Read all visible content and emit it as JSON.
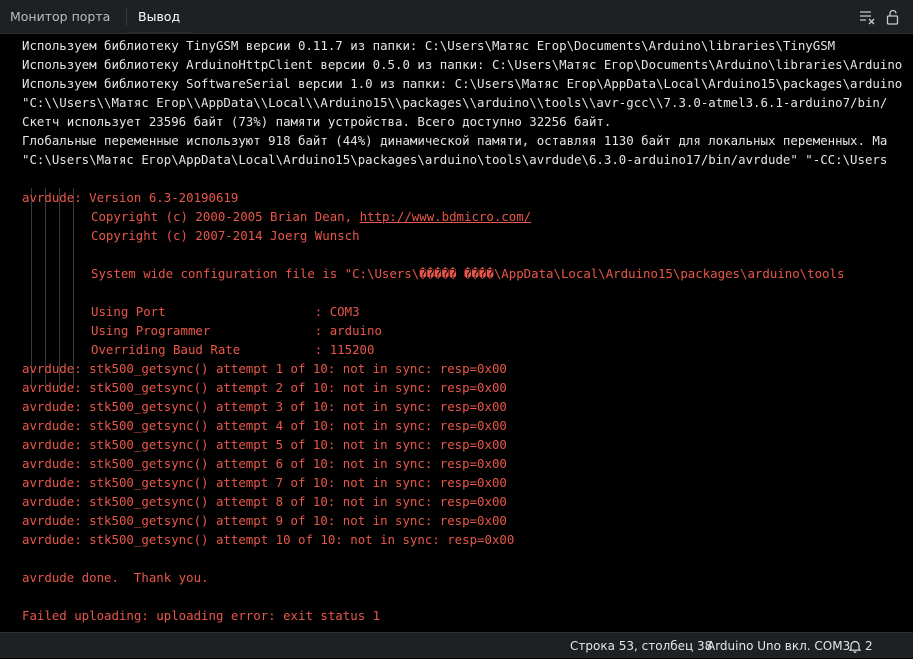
{
  "tabs": {
    "monitor": "Монитор порта",
    "output": "Вывод"
  },
  "toolbar": {
    "clear_icon": "clear-output-icon",
    "lock_icon": "unlock-scroll-icon"
  },
  "console": {
    "lines": [
      {
        "text": "Используем библиотеку TinyGSM версии 0.11.7 из папки: C:\\Users\\Матяс Егор\\Documents\\Arduino\\libraries\\TinyGSM",
        "type": "normal"
      },
      {
        "text": "Используем библиотеку ArduinoHttpClient версии 0.5.0 из папки: C:\\Users\\Матяс Егор\\Documents\\Arduino\\libraries\\Arduino",
        "type": "normal"
      },
      {
        "text": "Используем библиотеку SoftwareSerial версии 1.0 из папки: C:\\Users\\Матяс Егор\\AppData\\Local\\Arduino15\\packages\\arduino",
        "type": "normal"
      },
      {
        "text": "\"C:\\\\Users\\\\Матяс Егор\\\\AppData\\\\Local\\\\Arduino15\\\\packages\\\\arduino\\\\tools\\\\avr-gcc\\\\7.3.0-atmel3.6.1-arduino7/bin/",
        "type": "normal"
      },
      {
        "text": "Скетч использует 23596 байт (73%) памяти устройства. Всего доступно 32256 байт.",
        "type": "normal"
      },
      {
        "text": "Глобальные переменные используют 918 байт (44%) динамической памяти, оставляя 1130 байт для локальных переменных. Ма",
        "type": "normal"
      },
      {
        "text": "\"C:\\Users\\Матяс Егор\\AppData\\Local\\Arduino15\\packages\\arduino\\tools\\avrdude\\6.3.0-arduino17/bin/avrdude\" \"-CC:\\Users",
        "type": "normal"
      },
      {
        "text": "",
        "type": "blank"
      },
      {
        "text": "avrdude: Version 6.3-20190619",
        "type": "err"
      },
      {
        "text": "Copyright (c) 2000-2005 Brian Dean, ",
        "link": "http://www.bdmicro.com/",
        "type": "err-indent"
      },
      {
        "text": "Copyright (c) 2007-2014 Joerg Wunsch",
        "type": "err-indent"
      },
      {
        "text": "",
        "type": "blank"
      },
      {
        "text": "System wide configuration file is \"C:\\Users\\����� ����\\AppData\\Local\\Arduino15\\packages\\arduino\\tools",
        "type": "err-indent"
      },
      {
        "text": "",
        "type": "blank"
      },
      {
        "text": "Using Port                    : COM3",
        "type": "err-indent"
      },
      {
        "text": "Using Programmer              : arduino",
        "type": "err-indent"
      },
      {
        "text": "Overriding Baud Rate          : 115200",
        "type": "err-indent"
      },
      {
        "text": "avrdude: stk500_getsync() attempt 1 of 10: not in sync: resp=0x00",
        "type": "err"
      },
      {
        "text": "avrdude: stk500_getsync() attempt 2 of 10: not in sync: resp=0x00",
        "type": "err"
      },
      {
        "text": "avrdude: stk500_getsync() attempt 3 of 10: not in sync: resp=0x00",
        "type": "err"
      },
      {
        "text": "avrdude: stk500_getsync() attempt 4 of 10: not in sync: resp=0x00",
        "type": "err"
      },
      {
        "text": "avrdude: stk500_getsync() attempt 5 of 10: not in sync: resp=0x00",
        "type": "err"
      },
      {
        "text": "avrdude: stk500_getsync() attempt 6 of 10: not in sync: resp=0x00",
        "type": "err"
      },
      {
        "text": "avrdude: stk500_getsync() attempt 7 of 10: not in sync: resp=0x00",
        "type": "err"
      },
      {
        "text": "avrdude: stk500_getsync() attempt 8 of 10: not in sync: resp=0x00",
        "type": "err"
      },
      {
        "text": "avrdude: stk500_getsync() attempt 9 of 10: not in sync: resp=0x00",
        "type": "err"
      },
      {
        "text": "avrdude: stk500_getsync() attempt 10 of 10: not in sync: resp=0x00",
        "type": "err"
      },
      {
        "text": "",
        "type": "blank"
      },
      {
        "text": "avrdude done.  Thank you.",
        "type": "err"
      },
      {
        "text": "",
        "type": "blank"
      },
      {
        "text": "Failed uploading: uploading error: exit status 1",
        "type": "err"
      }
    ]
  },
  "statusbar": {
    "position": "Строка 53, столбец 38",
    "board": "Arduino Uno вкл. COM3",
    "notifications": "2",
    "notification_icon": "bell-icon"
  },
  "colors": {
    "background": "#000000",
    "text": "#e6e6e6",
    "error": "#e8574a",
    "bar": "#1e2124"
  }
}
